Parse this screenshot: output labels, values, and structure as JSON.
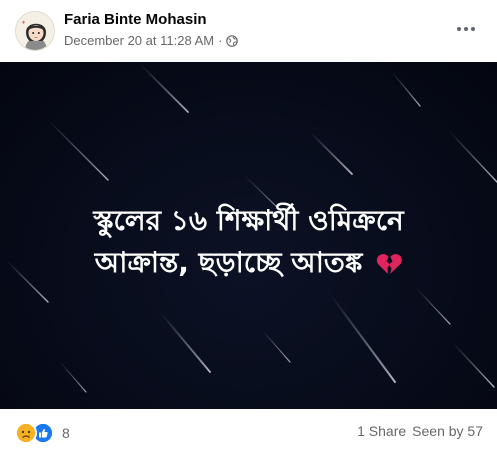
{
  "post": {
    "author": "Faria Binte Mohasin",
    "timestamp": "December 20 at 11:28 AM",
    "separator": "·",
    "privacy_icon": "globe-icon",
    "more_icon": "more-options-icon"
  },
  "media": {
    "caption_line1": "স্কুলের ১৬ শিক্ষার্থী ওমিক্রনে",
    "caption_line2": "আক্রান্ত, ছড়াচ্ছে আতঙ্ক",
    "caption_emoji_icon": "broken-heart-icon",
    "background_color": "#060a17"
  },
  "footer": {
    "reaction_icons": [
      "sad-reaction-icon",
      "like-reaction-icon"
    ],
    "reaction_count": "8",
    "shares": "1 Share",
    "seen_by": "Seen by 57"
  },
  "colors": {
    "secondary_text": "#65676b",
    "like_blue": "#1877f2",
    "sad_yellow": "#f7b125",
    "heart_red": "#e0245e"
  }
}
